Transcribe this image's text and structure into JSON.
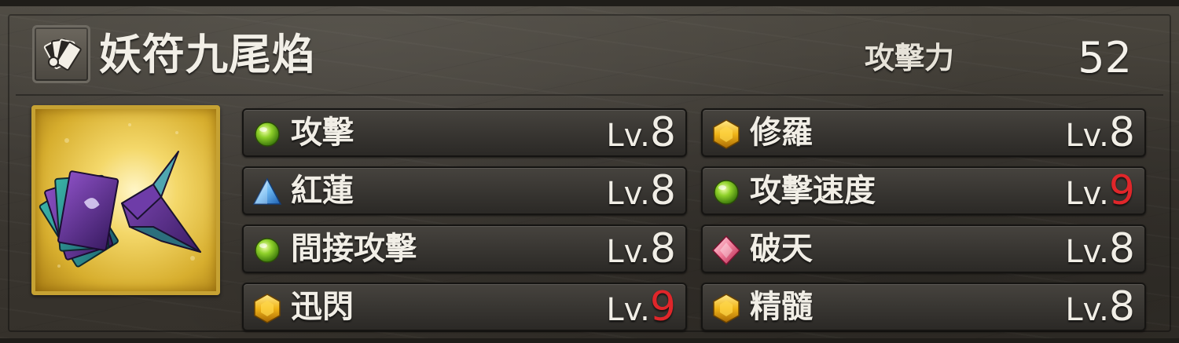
{
  "item": {
    "name": "妖符九尾焰",
    "type_icon": "talisman-cards-icon",
    "image_icon": "paper-crane-talisman-icon",
    "stat": {
      "label": "攻擊力",
      "value": "52"
    }
  },
  "skills": [
    {
      "name": "攻擊",
      "icon": "green-orb-icon",
      "level_prefix": "Lv.",
      "level": "8",
      "highlight": false
    },
    {
      "name": "修羅",
      "icon": "gold-hexagon-icon",
      "level_prefix": "Lv.",
      "level": "8",
      "highlight": false
    },
    {
      "name": "紅蓮",
      "icon": "blue-pyramid-icon",
      "level_prefix": "Lv.",
      "level": "8",
      "highlight": false
    },
    {
      "name": "攻擊速度",
      "icon": "green-orb-icon",
      "level_prefix": "Lv.",
      "level": "9",
      "highlight": true
    },
    {
      "name": "間接攻擊",
      "icon": "green-orb-icon",
      "level_prefix": "Lv.",
      "level": "8",
      "highlight": false
    },
    {
      "name": "破天",
      "icon": "pink-diamond-icon",
      "level_prefix": "Lv.",
      "level": "8",
      "highlight": false
    },
    {
      "name": "迅閃",
      "icon": "gold-hexagon-icon",
      "level_prefix": "Lv.",
      "level": "9",
      "highlight": true
    },
    {
      "name": "精髓",
      "icon": "gold-hexagon-icon",
      "level_prefix": "Lv.",
      "level": "8",
      "highlight": false
    }
  ],
  "colors": {
    "max_level": "#e0262a",
    "text": "#f1eee6",
    "image_frame": "#c6a233"
  }
}
